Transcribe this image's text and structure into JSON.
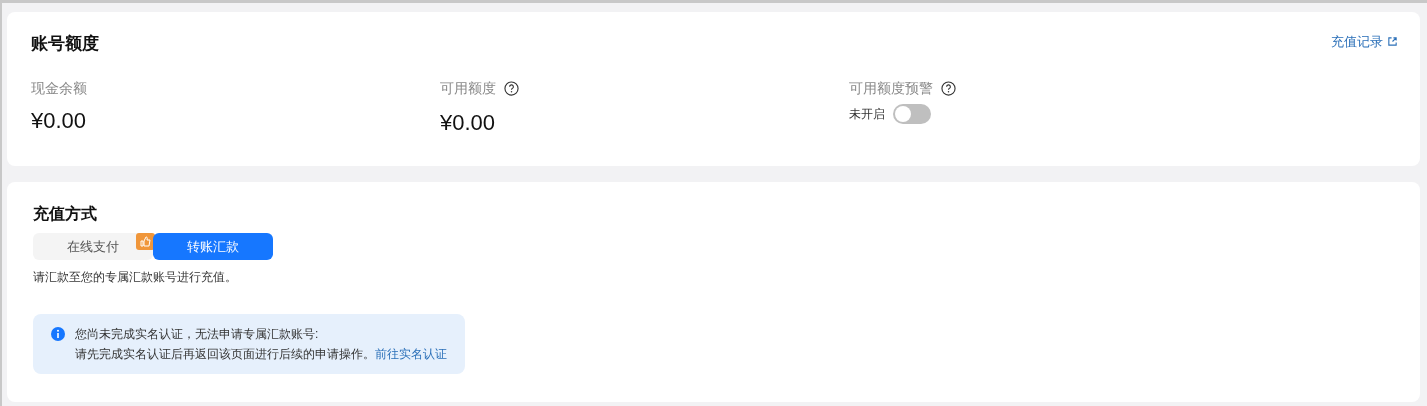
{
  "quota_card": {
    "title": "账号额度",
    "link": "充值记录",
    "metrics": [
      {
        "label": "现金余额",
        "value": "¥0.00",
        "help": false
      },
      {
        "label": "可用额度",
        "value": "¥0.00",
        "help": true
      }
    ],
    "alert_setting": {
      "label": "可用额度预警",
      "help": true,
      "state_text": "未开启",
      "on": false
    }
  },
  "recharge_card": {
    "title": "充值方式",
    "tabs": [
      {
        "label": "在线支付",
        "selected": false,
        "recommended": true
      },
      {
        "label": "转账汇款",
        "selected": true,
        "recommended": false
      }
    ],
    "hint": "请汇款至您的专属汇款账号进行充值。",
    "notice": {
      "line1": "您尚未完成实名认证，无法申请专属汇款账号:",
      "line2": "请先完成实名认证后再返回该页面进行后续的申请操作。",
      "link": "前往实名认证"
    }
  }
}
